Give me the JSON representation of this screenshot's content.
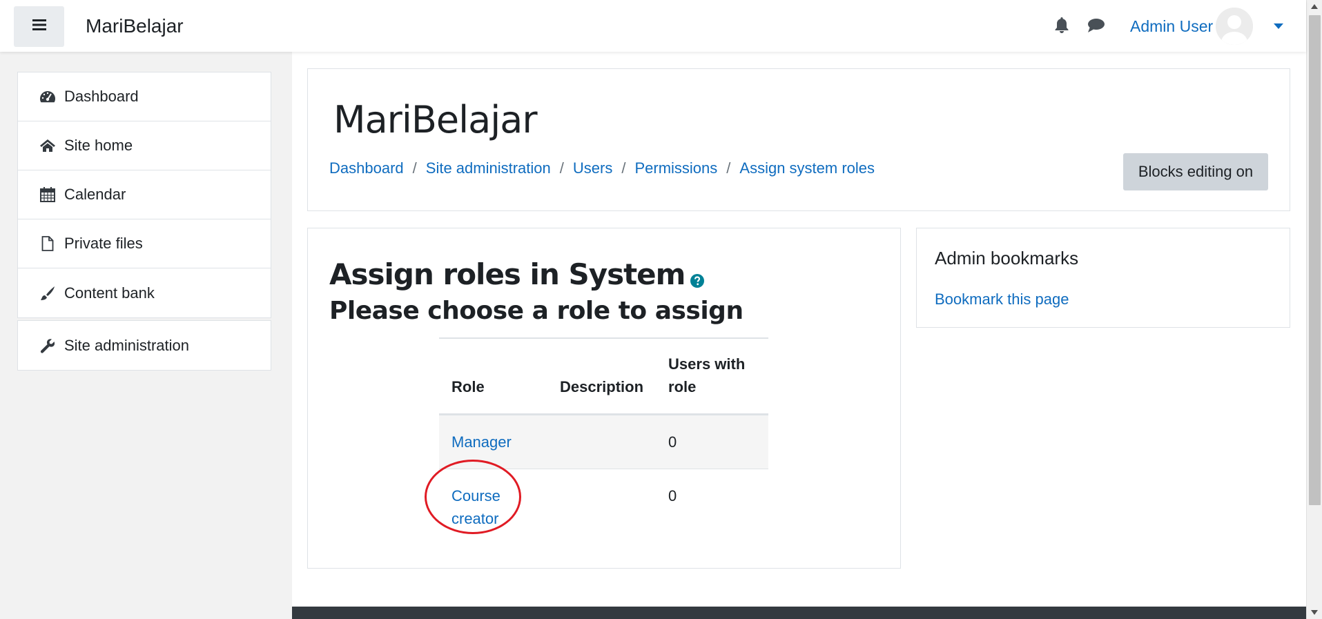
{
  "navbar": {
    "brand": "MariBelajar",
    "user_name": "Admin User",
    "icons": [
      "menu-icon",
      "bell-icon",
      "chat-icon",
      "avatar",
      "caret-down-icon"
    ]
  },
  "drawer": {
    "main_items": [
      {
        "label": "Dashboard",
        "icon": "dashboard-icon"
      },
      {
        "label": "Site home",
        "icon": "home-icon"
      },
      {
        "label": "Calendar",
        "icon": "calendar-icon"
      },
      {
        "label": "Private files",
        "icon": "file-icon"
      },
      {
        "label": "Content bank",
        "icon": "paintbrush-icon"
      }
    ],
    "admin_items": [
      {
        "label": "Site administration",
        "icon": "wrench-icon"
      }
    ]
  },
  "header": {
    "title": "MariBelajar",
    "breadcrumb": [
      "Dashboard",
      "Site administration",
      "Users",
      "Permissions",
      "Assign system roles"
    ],
    "separator": "/",
    "blocks_button": "Blocks editing on"
  },
  "main": {
    "heading": "Assign roles in System",
    "subheading": "Please choose a role to assign",
    "table": {
      "headers": {
        "role": "Role",
        "description": "Description",
        "users_with_role": "Users with role"
      },
      "rows": [
        {
          "role": "Manager",
          "description": "",
          "users": "0"
        },
        {
          "role": "Course creator",
          "description": "",
          "users": "0"
        }
      ]
    }
  },
  "bookmarks": {
    "title": "Admin bookmarks",
    "link": "Bookmark this page"
  },
  "colors": {
    "link": "#0f6cbf",
    "button_bg": "#ced4da",
    "highlight_circle": "#e01b24",
    "footer": "#343a40"
  }
}
